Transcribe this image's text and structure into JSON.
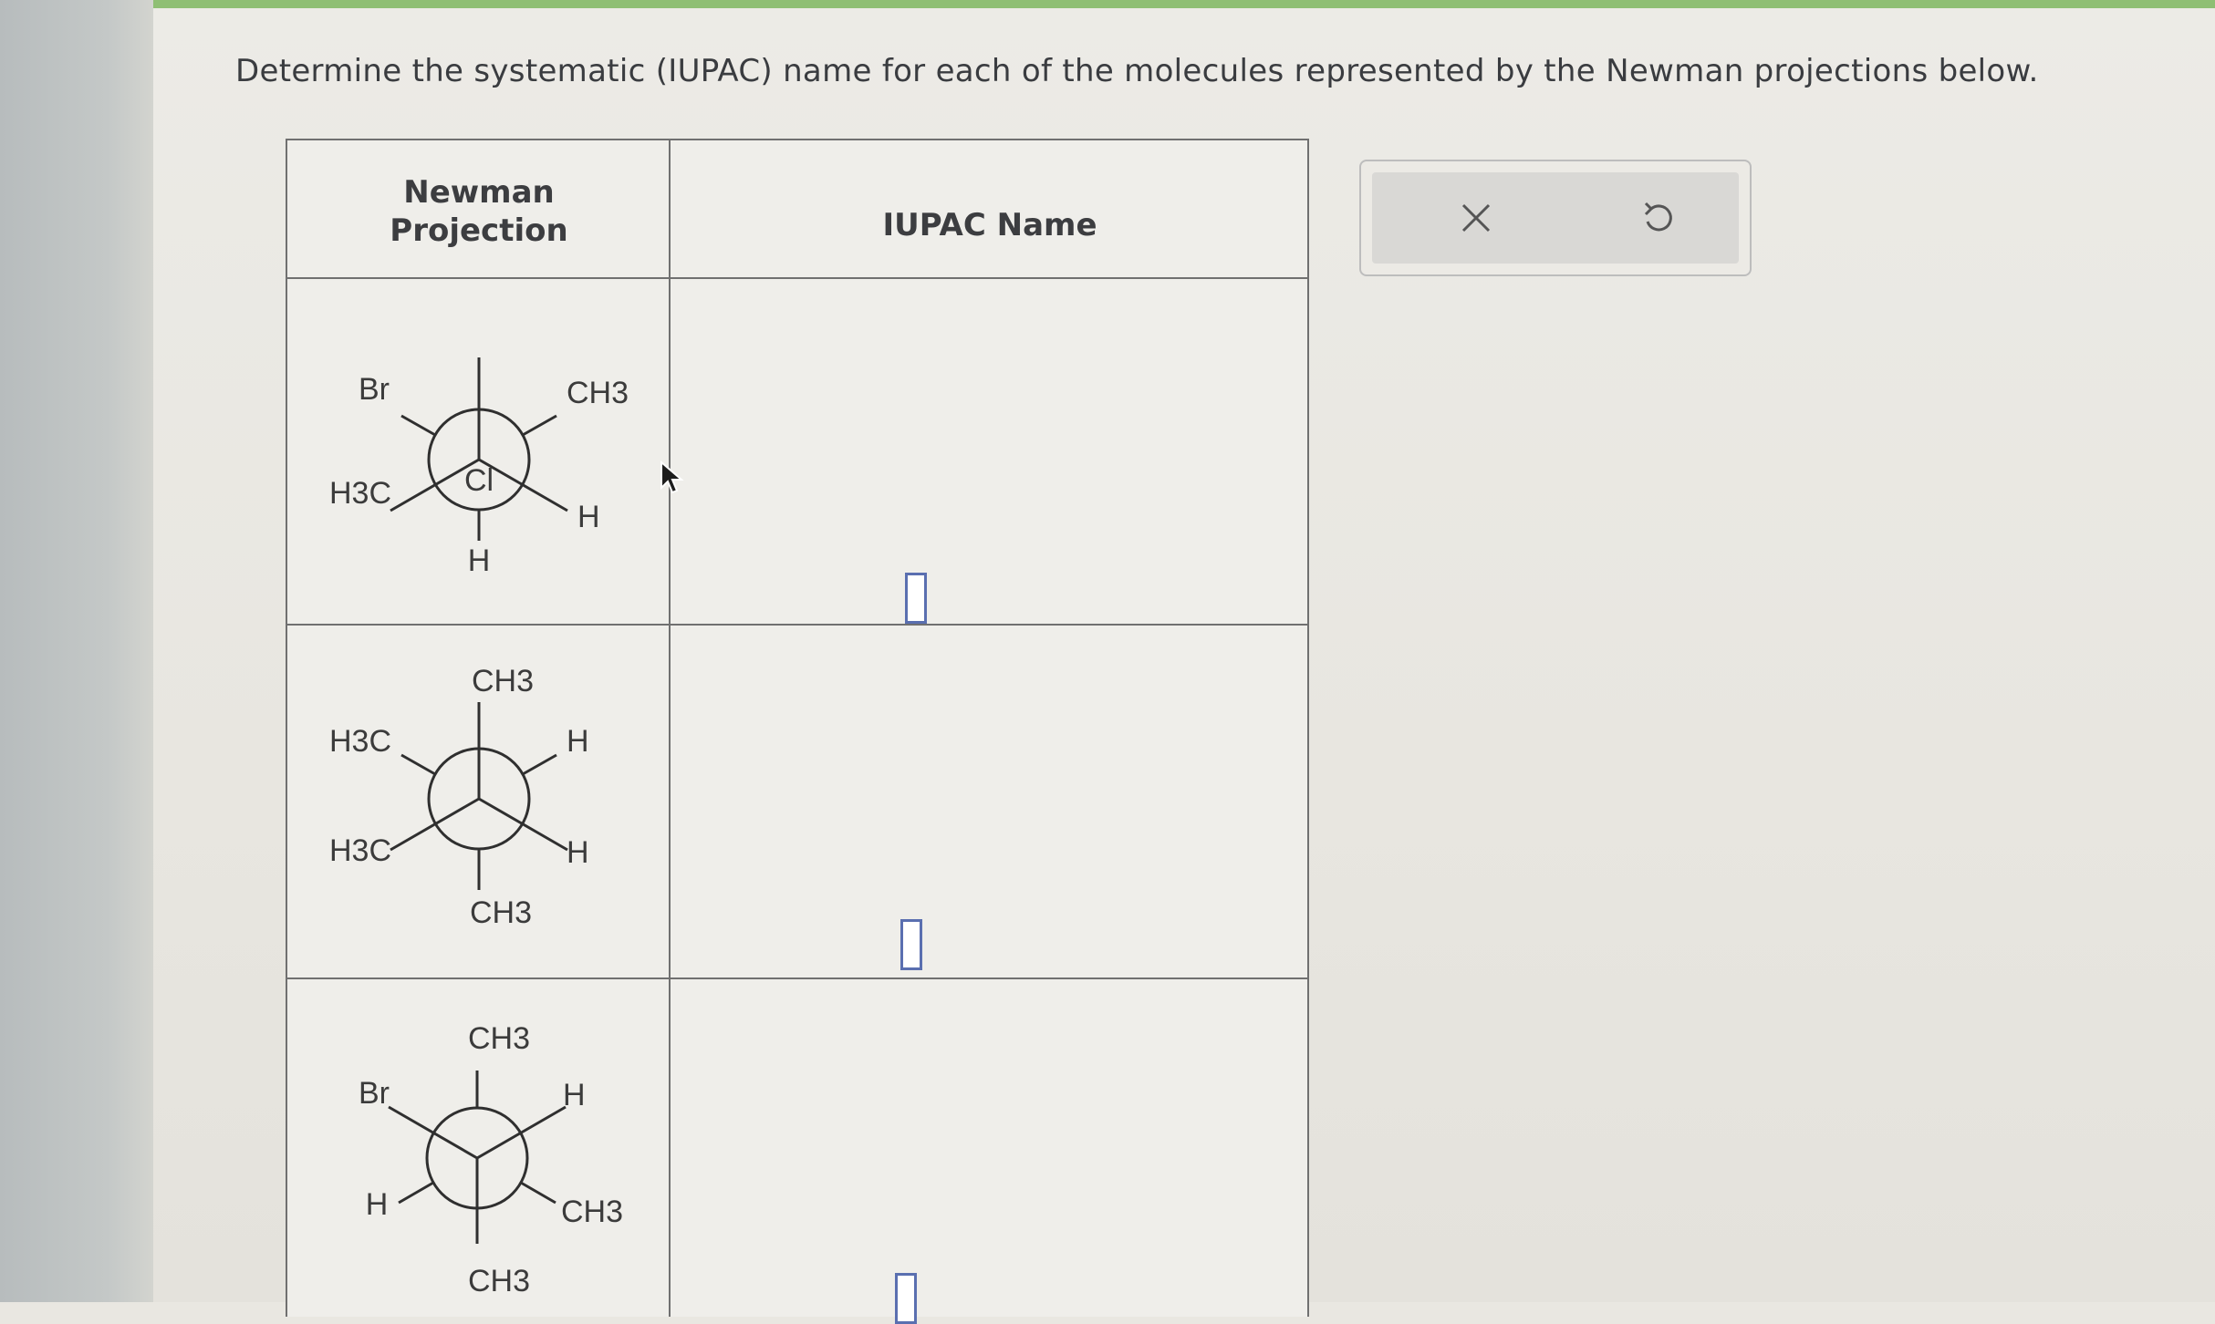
{
  "prompt": "Determine the systematic (IUPAC) name for each of the molecules represented by the Newman projections below.",
  "table": {
    "header_newman_line1": "Newman",
    "header_newman_line2": "Projection",
    "header_iupac": "IUPAC Name"
  },
  "rows": [
    {
      "front_top": "Cl",
      "front_left": "H3C",
      "front_right": "H",
      "back_bottom": "H",
      "back_upper_left": "Br",
      "back_upper_right": "CH3",
      "answer": ""
    },
    {
      "front_top": "CH3",
      "front_left": "H3C",
      "front_right": "H",
      "back_bottom": "CH3",
      "back_upper_left": "H3C",
      "back_upper_right": "H",
      "answer": ""
    },
    {
      "front_top": "CH3",
      "front_left": "H",
      "front_right": "CH3",
      "back_bottom": "CH3",
      "back_upper_left": "Br",
      "back_upper_right": "H",
      "answer": ""
    }
  ],
  "toolbar": {
    "clear": "clear-icon",
    "undo": "undo-icon"
  },
  "colors": {
    "top_bar": "#8fbf74",
    "answer_border": "#5a6fb0",
    "table_line": "#707070"
  }
}
